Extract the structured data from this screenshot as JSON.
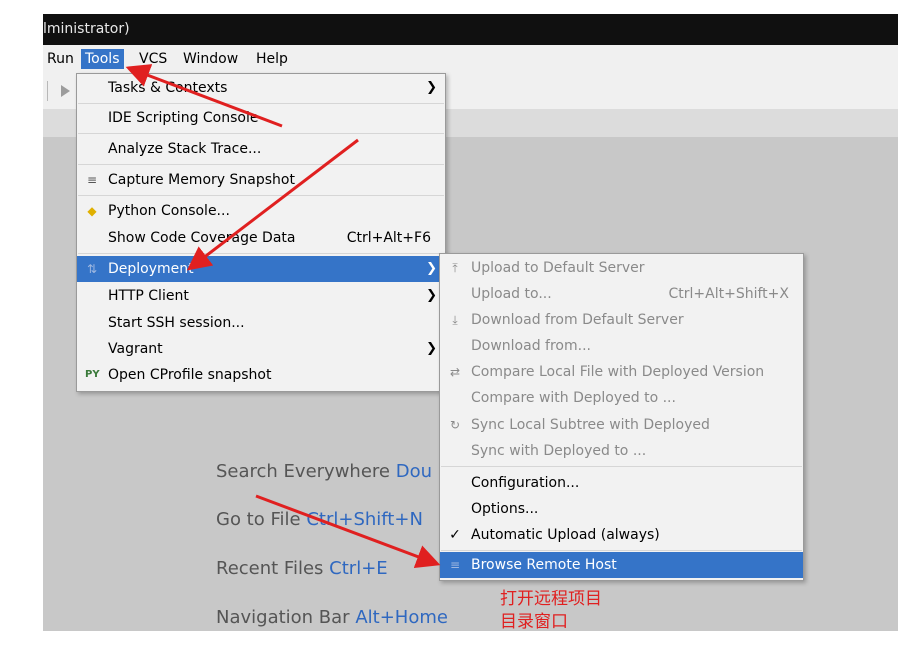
{
  "title_fragment": "lministrator)",
  "menubar": {
    "run": "Run",
    "tools": "Tools",
    "vcs": "VCS",
    "window": "Window",
    "help": "Help"
  },
  "editor_hints": [
    {
      "label": "Search Everywhere",
      "key": "Dou"
    },
    {
      "label": "Go to File",
      "key": "Ctrl+Shift+N"
    },
    {
      "label": "Recent Files",
      "key": "Ctrl+E"
    },
    {
      "label": "Navigation Bar",
      "key": "Alt+Home"
    }
  ],
  "tools_menu": [
    {
      "label": "Tasks & Contexts",
      "submenu": true
    },
    {
      "label": "IDE Scripting Console"
    },
    {
      "label": "Analyze Stack Trace..."
    },
    {
      "label": "Capture Memory Snapshot",
      "icon": "memory-snapshot-icon"
    },
    {
      "label": "Python Console...",
      "icon": "python-icon"
    },
    {
      "label": "Show Code Coverage Data",
      "shortcut": "Ctrl+Alt+F6"
    },
    {
      "label": "Deployment",
      "submenu": true,
      "selected": true,
      "icon": "deployment-icon"
    },
    {
      "label": "HTTP Client",
      "submenu": true
    },
    {
      "label": "Start SSH session..."
    },
    {
      "label": "Vagrant",
      "submenu": true
    },
    {
      "label": "Open CProfile snapshot",
      "icon": "cprofile-icon"
    }
  ],
  "deployment_menu": [
    {
      "label": "Upload to Default Server",
      "icon": "upload-icon",
      "enabled": false
    },
    {
      "label": "Upload to...",
      "shortcut": "Ctrl+Alt+Shift+X",
      "enabled": false
    },
    {
      "label": "Download from Default Server",
      "icon": "download-icon",
      "enabled": false
    },
    {
      "label": "Download from...",
      "enabled": false
    },
    {
      "label": "Compare Local File with Deployed Version",
      "icon": "compare-icon",
      "enabled": false
    },
    {
      "label": "Compare with Deployed to ...",
      "enabled": false
    },
    {
      "label": "Sync Local Subtree with Deployed",
      "icon": "sync-icon",
      "enabled": false
    },
    {
      "label": "Sync with Deployed to ...",
      "enabled": false
    },
    {
      "label": "Configuration...",
      "enabled": true
    },
    {
      "label": "Options...",
      "enabled": true
    },
    {
      "label": "Automatic Upload (always)",
      "enabled": true,
      "checked": true
    },
    {
      "label": "Browse Remote Host",
      "enabled": true,
      "selected": true,
      "icon": "remote-host-icon"
    }
  ],
  "annotation": {
    "line1": "打开远程项目",
    "line2": "目录窗口"
  },
  "colors": {
    "selection": "#3574c8",
    "annotation_red": "#e02020",
    "shortcut_blue": "#2f68c0"
  }
}
